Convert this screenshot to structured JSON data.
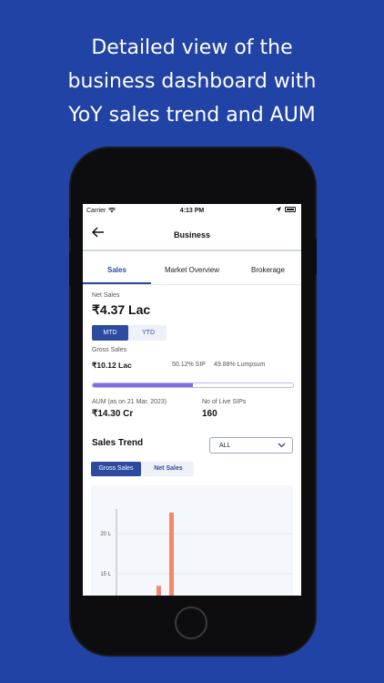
{
  "headline": {
    "line1": "Detailed view of the",
    "line2": "business dashboard with",
    "line3": "YoY sales trend and AUM"
  },
  "status_bar": {
    "carrier": "Carrier",
    "time": "4:13 PM"
  },
  "nav": {
    "title": "Business",
    "back_icon": "back-arrow-icon"
  },
  "tabs": [
    {
      "label": "Sales",
      "active": true
    },
    {
      "label": "Market Overview",
      "active": false
    },
    {
      "label": "Brokerage",
      "active": false
    }
  ],
  "net_sales": {
    "label": "Net Sales",
    "value": "₹4.37 Lac"
  },
  "period_toggle": {
    "options": [
      "MTD",
      "YTD"
    ],
    "selected": "MTD"
  },
  "gross_sales": {
    "label": "Gross Sales",
    "value": "₹10.12 Lac",
    "sip": "50.12% SIP",
    "lumpsum": "49.88% Lumpsum",
    "sip_fraction": 0.5012
  },
  "aum": {
    "label": "AUM (as on 21 Mar, 2023)",
    "value": "₹14.30 Cr"
  },
  "live_sips": {
    "label": "No of Live SIPs",
    "value": "160"
  },
  "sales_trend": {
    "title": "Sales Trend",
    "filter_value": "ALL",
    "series_toggle": [
      "Gross Sales",
      "Net Sales"
    ],
    "selected_series": "Gross Sales"
  },
  "colors": {
    "accent": "#2b4aa0",
    "background": "#2143a6",
    "bar": "#f08a6e",
    "progress": "#7c6fe0"
  },
  "chart_data": {
    "type": "bar",
    "y_ticks": [
      "20 L",
      "15 L"
    ],
    "series": [
      {
        "values": [
          14,
          24.5
        ]
      }
    ],
    "ylim": [
      10,
      25
    ]
  }
}
